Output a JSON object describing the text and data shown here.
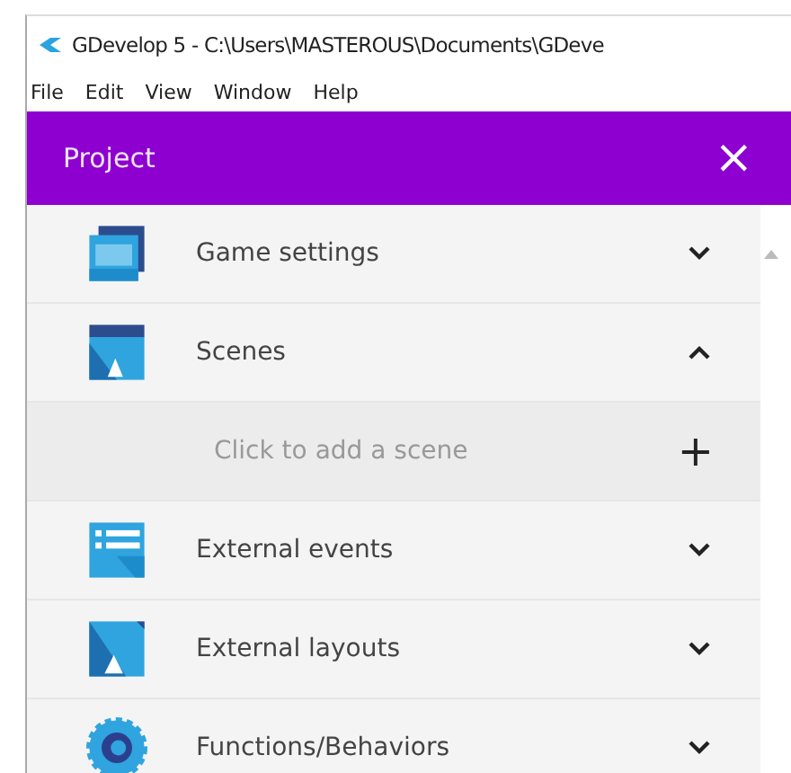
{
  "window": {
    "title": "GDevelop 5 - C:\\Users\\MASTEROUS\\Documents\\GDeve"
  },
  "menu": [
    "File",
    "Edit",
    "View",
    "Window",
    "Help"
  ],
  "panel": {
    "title": "Project",
    "close": "×"
  },
  "items": [
    {
      "kind": "section",
      "label": "Game settings",
      "expanded": false
    },
    {
      "kind": "section",
      "label": "Scenes",
      "expanded": true
    },
    {
      "kind": "add",
      "label": "Click to add a scene",
      "action": "+"
    },
    {
      "kind": "section",
      "label": "External events",
      "expanded": false
    },
    {
      "kind": "section",
      "label": "External layouts",
      "expanded": false
    },
    {
      "kind": "section",
      "label": "Functions/Behaviors",
      "expanded": false
    }
  ]
}
